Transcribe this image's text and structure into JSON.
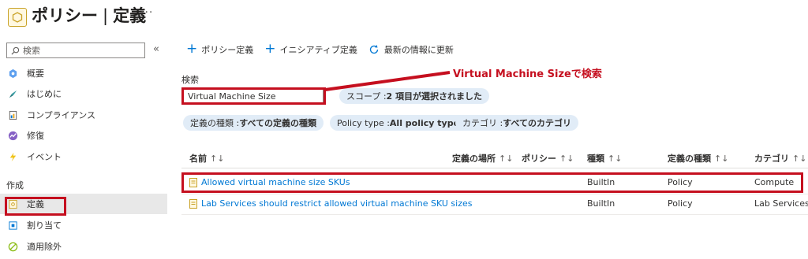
{
  "header": {
    "title": "ポリシー",
    "separator": "|",
    "subtitle": "定義",
    "more": "···"
  },
  "sidebar": {
    "search_placeholder": "検索",
    "collapse": "«",
    "items": [
      {
        "label": "概要",
        "icon": "overview-icon"
      },
      {
        "label": "はじめに",
        "icon": "getting-started-icon"
      },
      {
        "label": "コンプライアンス",
        "icon": "compliance-icon"
      },
      {
        "label": "修復",
        "icon": "remediation-icon"
      },
      {
        "label": "イベント",
        "icon": "events-icon"
      }
    ],
    "section_label": "作成",
    "authoring": [
      {
        "label": "定義",
        "icon": "definitions-icon",
        "selected": true
      },
      {
        "label": "割り当て",
        "icon": "assignments-icon"
      },
      {
        "label": "適用除外",
        "icon": "exemptions-icon"
      }
    ]
  },
  "toolbar": {
    "policy_definition": "ポリシー定義",
    "initiative_definition": "イニシアティブ定義",
    "refresh": "最新の情報に更新"
  },
  "filters": {
    "search_label": "検索",
    "search_value": "Virtual Machine Size",
    "scope_pill": {
      "label": "スコープ : ",
      "value": "2 項目が選択されました"
    },
    "definition_type_pill": {
      "label": "定義の種類 : ",
      "value": "すべての定義の種類"
    },
    "policy_type_pill": {
      "label": "Policy type : ",
      "value": "All policy types"
    },
    "category_pill": {
      "label": "カテゴリ : ",
      "value": "すべてのカテゴリ"
    }
  },
  "annotation": {
    "text": "Virtual Machine Sizeで検索",
    "color": "#c50f1f"
  },
  "table": {
    "columns": [
      "名前",
      "定義の場所",
      "ポリシー",
      "種類",
      "定義の種類",
      "カテゴリ"
    ],
    "sort_glyph": "↑↓",
    "rows": [
      {
        "name": "Allowed virtual machine size SKUs",
        "location": "",
        "policies": "",
        "type": "BuiltIn",
        "definition_type": "Policy",
        "category": "Compute",
        "highlighted": true
      },
      {
        "name": "Lab Services should restrict allowed virtual machine SKU sizes",
        "location": "",
        "policies": "",
        "type": "BuiltIn",
        "definition_type": "Policy",
        "category": "Lab Services",
        "highlighted": false
      }
    ]
  },
  "colors": {
    "accent": "#0078d4",
    "highlight": "#c50f1f",
    "pill_bg": "#e1ecf7"
  }
}
